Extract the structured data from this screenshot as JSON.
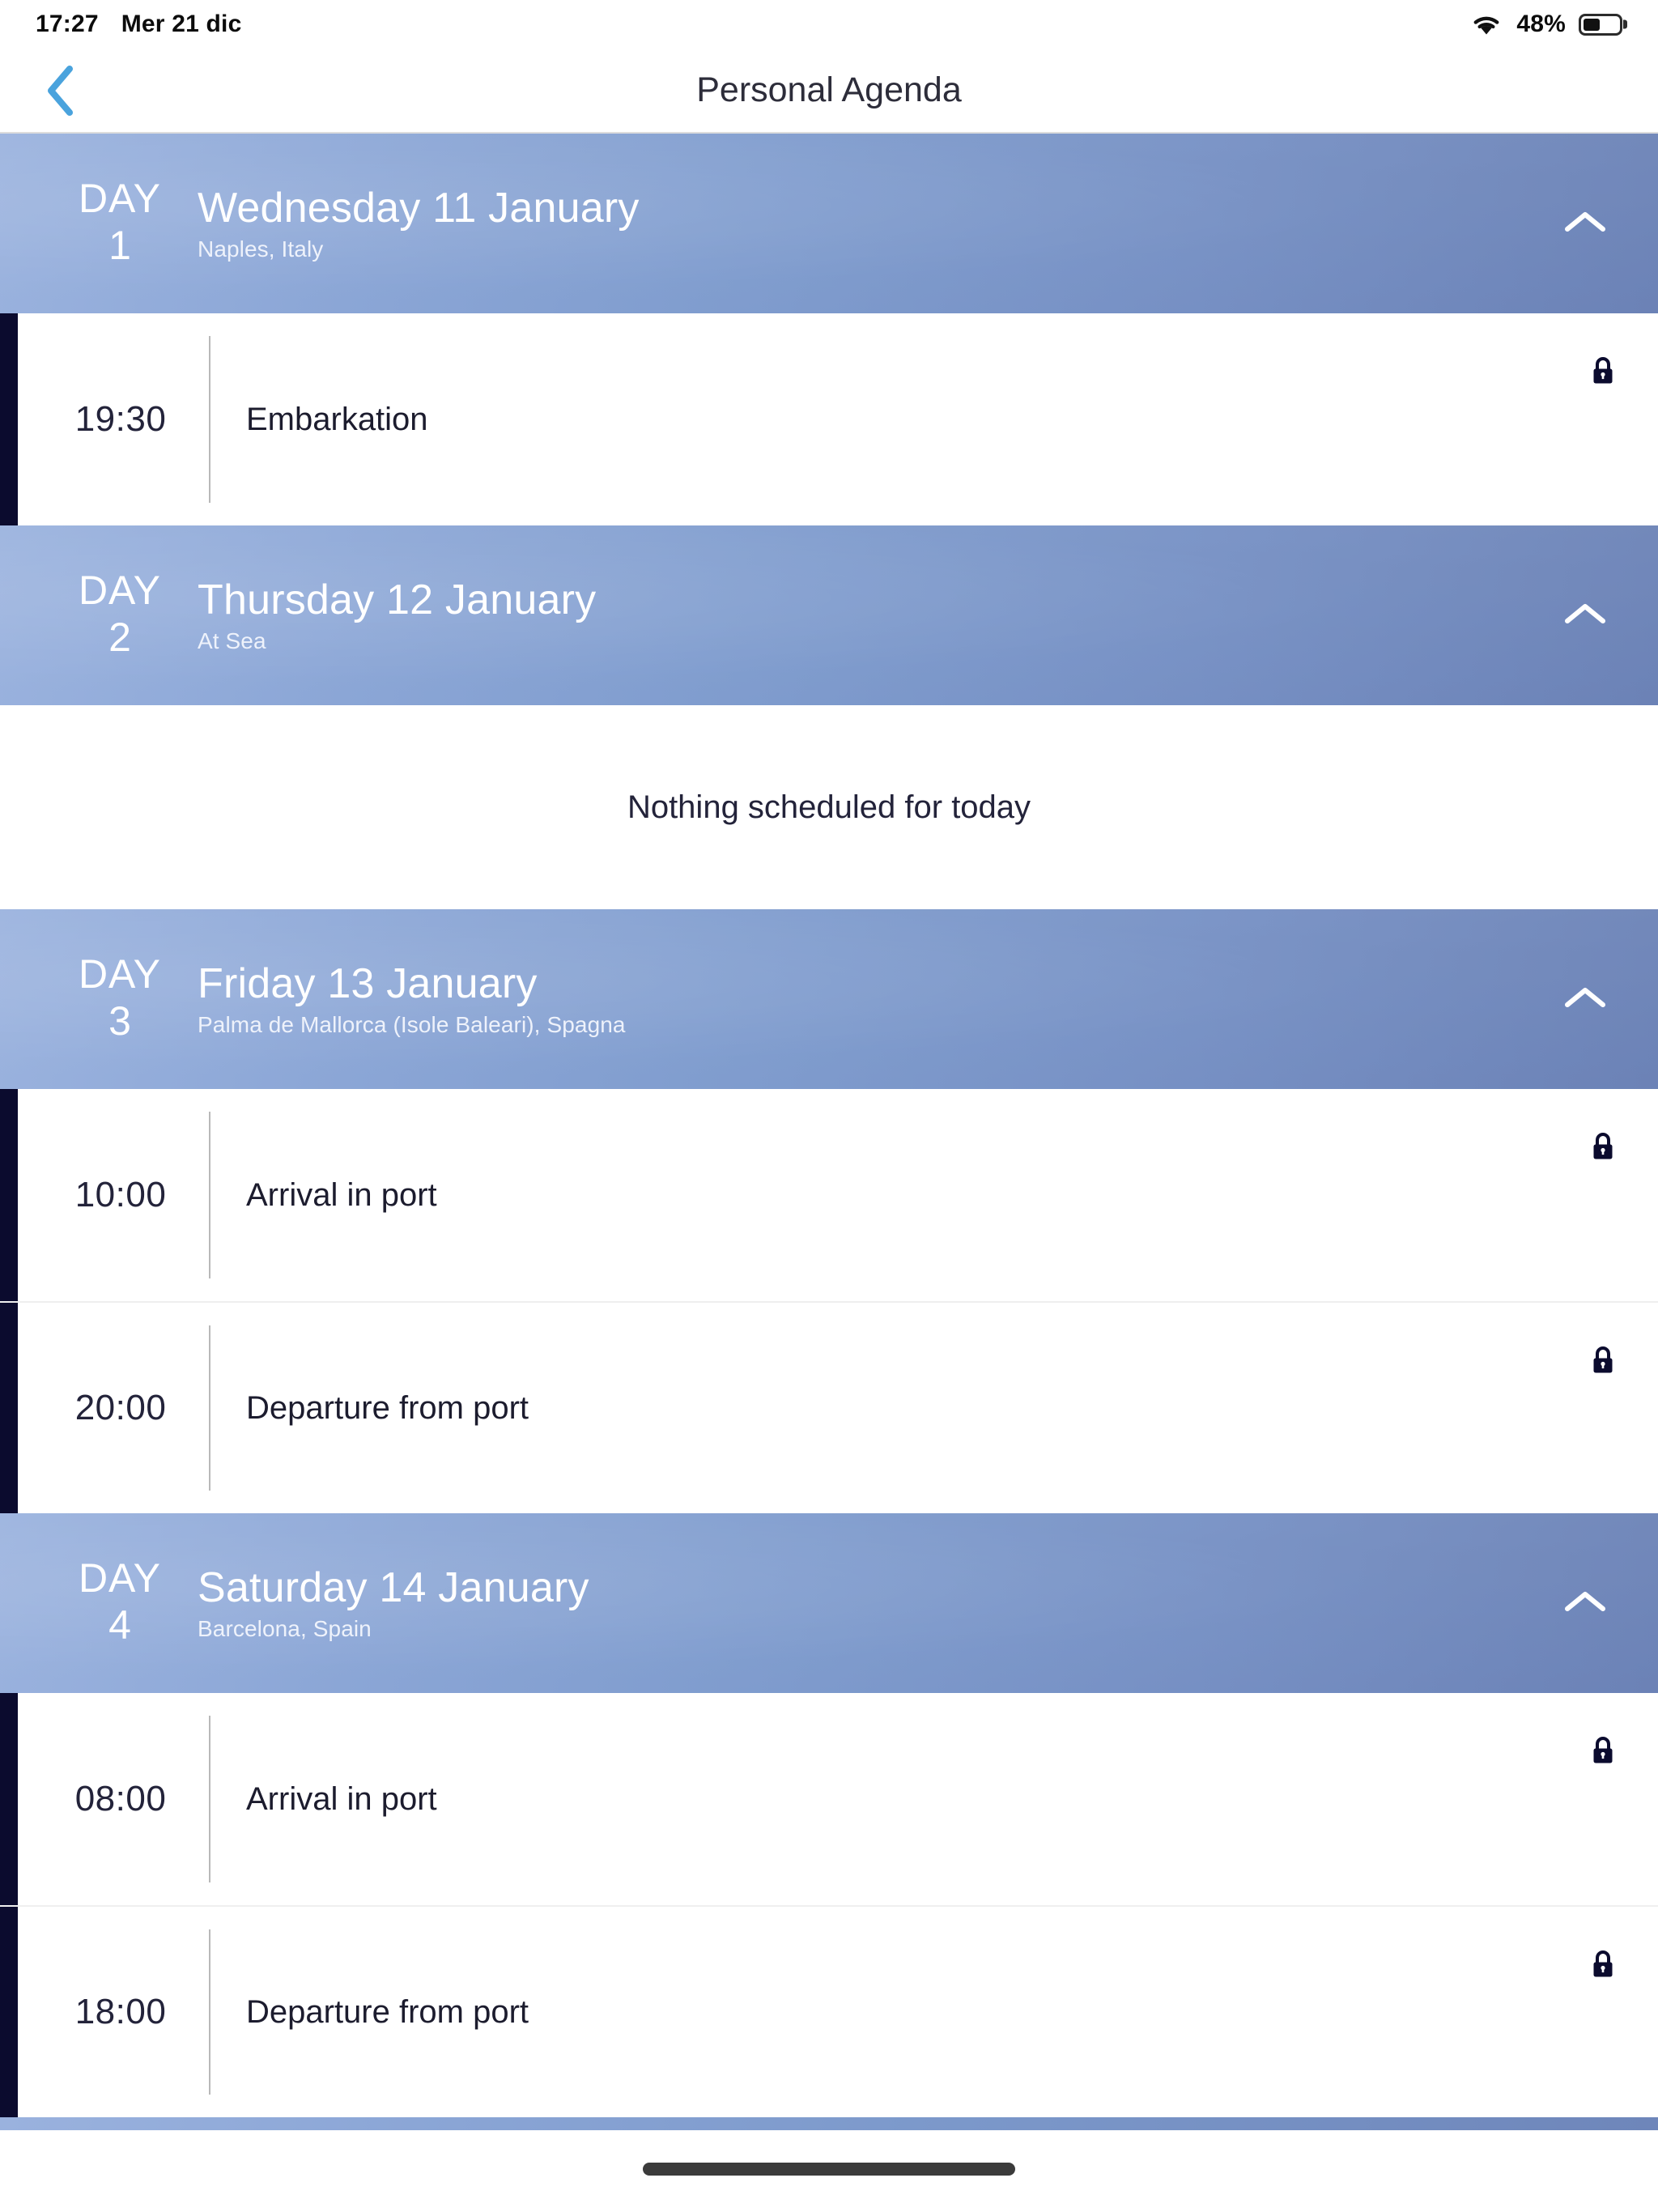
{
  "status_bar": {
    "time": "17:27",
    "date": "Mer 21 dic",
    "battery_percent": "48%",
    "battery_level": 48,
    "wifi_icon": "wifi-icon",
    "battery_icon": "battery-icon"
  },
  "nav": {
    "title": "Personal Agenda",
    "back_icon": "chevron-left-icon",
    "back_color": "#4aa3dd"
  },
  "colors": {
    "day_header_gradient_start": "#9ab2de",
    "day_header_gradient_end": "#6b82b6",
    "event_accent": "#0b0b2e",
    "lock_icon": "#0b0b2e",
    "text_dark": "#23233a",
    "back_arrow": "#4aa3dd"
  },
  "empty_state": {
    "message": "Nothing scheduled for today"
  },
  "days": [
    {
      "day_word": "DAY",
      "day_number": "1",
      "date": "Wednesday 11 January",
      "location": "Naples, Italy",
      "collapse_icon": "chevron-up-icon",
      "expanded": true,
      "empty": false,
      "events": [
        {
          "time": "19:30",
          "title": "Embarkation",
          "lock_icon": "lock-closed-icon"
        }
      ]
    },
    {
      "day_word": "DAY",
      "day_number": "2",
      "date": "Thursday 12 January",
      "location": "At Sea",
      "collapse_icon": "chevron-up-icon",
      "expanded": true,
      "empty": true,
      "events": []
    },
    {
      "day_word": "DAY",
      "day_number": "3",
      "date": "Friday 13 January",
      "location": "Palma de Mallorca (Isole Baleari), Spagna",
      "collapse_icon": "chevron-up-icon",
      "expanded": true,
      "empty": false,
      "events": [
        {
          "time": "10:00",
          "title": "Arrival in port",
          "lock_icon": "lock-closed-icon"
        },
        {
          "time": "20:00",
          "title": "Departure from port",
          "lock_icon": "lock-closed-icon"
        }
      ]
    },
    {
      "day_word": "DAY",
      "day_number": "4",
      "date": "Saturday 14 January",
      "location": "Barcelona, Spain",
      "collapse_icon": "chevron-up-icon",
      "expanded": true,
      "empty": false,
      "events": [
        {
          "time": "08:00",
          "title": "Arrival in port",
          "lock_icon": "lock-closed-icon"
        },
        {
          "time": "18:00",
          "title": "Departure from port",
          "lock_icon": "lock-closed-icon"
        }
      ]
    }
  ]
}
